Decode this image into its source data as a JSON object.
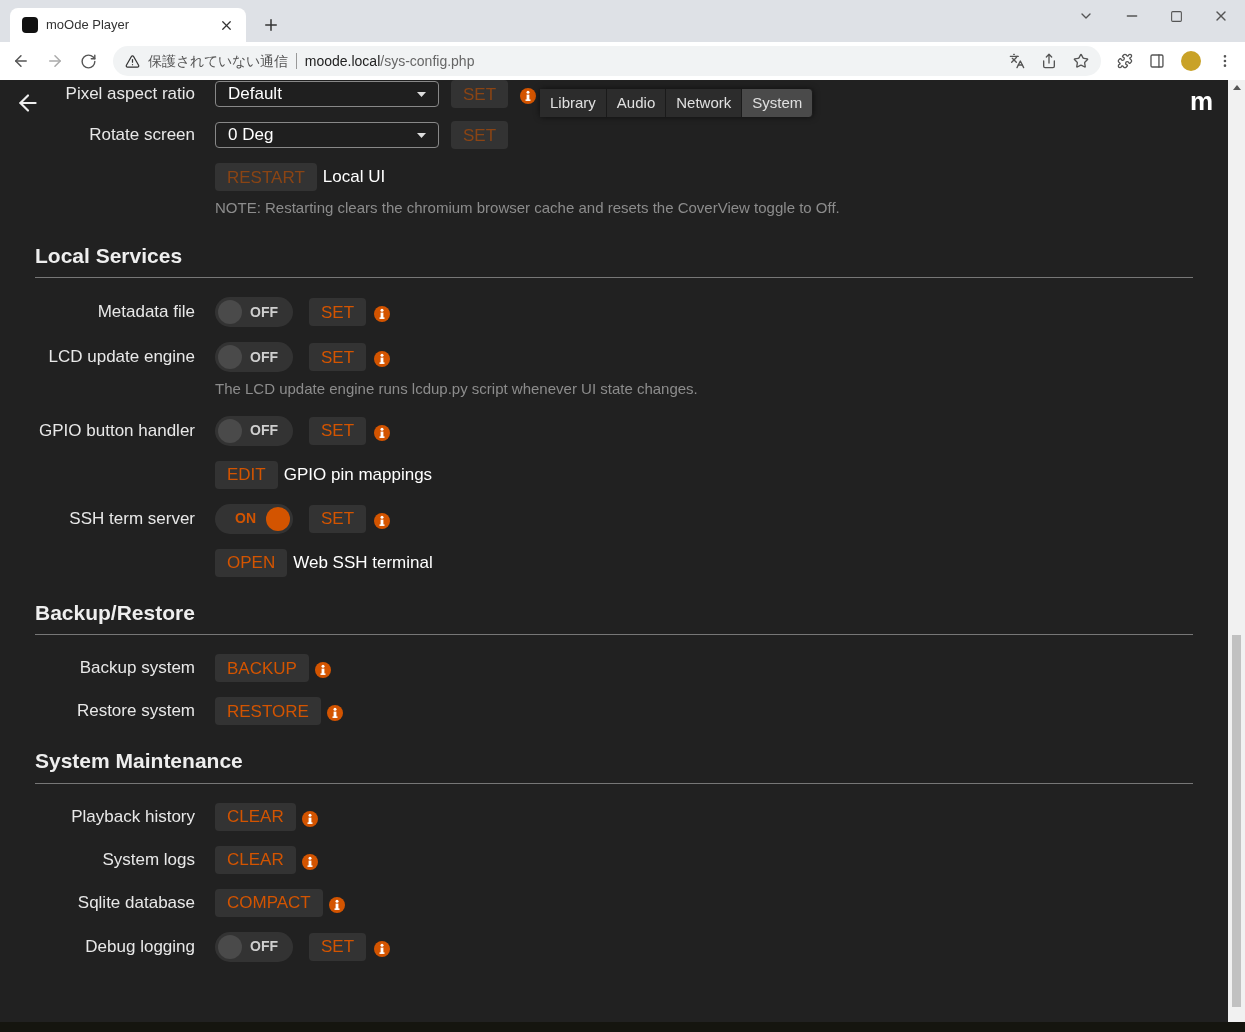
{
  "browser": {
    "tab_title": "moOde Player",
    "security": "保護されていない通信",
    "host": "moode.local",
    "path": "/sys-config.php"
  },
  "header": {
    "logo": "m",
    "tabs": [
      {
        "label": "Library",
        "selected": false
      },
      {
        "label": "Audio",
        "selected": false
      },
      {
        "label": "Network",
        "selected": false
      },
      {
        "label": "System",
        "selected": true
      }
    ]
  },
  "sections": [
    {
      "rows": [
        {
          "kind": "select",
          "label": "Pixel aspect ratio",
          "value": "Default",
          "button": {
            "label": "SET",
            "disabled": true
          },
          "info": true
        },
        {
          "kind": "select",
          "label": "Rotate screen",
          "value": "0 Deg",
          "button": {
            "label": "SET",
            "disabled": true
          },
          "info": false
        },
        {
          "kind": "action",
          "button": {
            "label": "RESTART",
            "disabled": true
          },
          "text": "Local UI",
          "info": false
        },
        {
          "kind": "note",
          "text": "NOTE: Restarting clears the chromium browser cache and resets the CoverView toggle to Off."
        }
      ]
    },
    {
      "title": "Local Services",
      "rows": [
        {
          "kind": "toggle",
          "label": "Metadata file",
          "on": false,
          "state_text": "OFF",
          "button": {
            "label": "SET",
            "disabled": false
          },
          "info": true
        },
        {
          "kind": "toggle",
          "label": "LCD update engine",
          "on": false,
          "state_text": "OFF",
          "button": {
            "label": "SET",
            "disabled": false
          },
          "info": true
        },
        {
          "kind": "note",
          "text": "The LCD update engine runs lcdup.py script whenever UI state changes."
        },
        {
          "kind": "toggle",
          "label": "GPIO button handler",
          "on": false,
          "state_text": "OFF",
          "button": {
            "label": "SET",
            "disabled": false
          },
          "info": true
        },
        {
          "kind": "action",
          "button": {
            "label": "EDIT",
            "disabled": false
          },
          "text": "GPIO pin mappings",
          "info": false
        },
        {
          "kind": "toggle",
          "label": "SSH term server",
          "on": true,
          "state_text": "ON",
          "button": {
            "label": "SET",
            "disabled": false
          },
          "info": true
        },
        {
          "kind": "action",
          "button": {
            "label": "OPEN",
            "disabled": false
          },
          "text": "Web SSH terminal",
          "info": false
        }
      ]
    },
    {
      "title": "Backup/Restore",
      "rows": [
        {
          "kind": "action",
          "label": "Backup system",
          "button": {
            "label": "BACKUP",
            "disabled": false
          },
          "info": true
        },
        {
          "kind": "action",
          "label": "Restore system",
          "button": {
            "label": "RESTORE",
            "disabled": false
          },
          "info": true
        }
      ]
    },
    {
      "title": "System Maintenance",
      "rows": [
        {
          "kind": "action",
          "label": "Playback history",
          "button": {
            "label": "CLEAR",
            "disabled": false
          },
          "info": true
        },
        {
          "kind": "action",
          "label": "System logs",
          "button": {
            "label": "CLEAR",
            "disabled": false
          },
          "info": true
        },
        {
          "kind": "action",
          "label": "Sqlite database",
          "button": {
            "label": "COMPACT",
            "disabled": false
          },
          "info": true
        },
        {
          "kind": "toggle",
          "label": "Debug logging",
          "on": false,
          "state_text": "OFF",
          "button": {
            "label": "SET",
            "disabled": false
          },
          "info": true
        }
      ]
    }
  ]
}
